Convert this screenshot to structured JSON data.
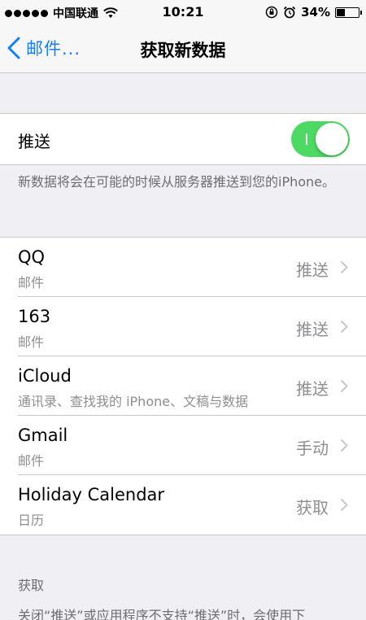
{
  "status_bar": {
    "carrier": "中国联通",
    "time": "10:21",
    "battery_percent": "34%",
    "battery_level": 0.34,
    "signal_bars": 5,
    "icons": [
      "wifi-icon",
      "orientation-lock-icon",
      "alarm-icon",
      "battery-icon"
    ]
  },
  "nav": {
    "back_label": "邮件...",
    "title": "获取新数据"
  },
  "push": {
    "label": "推送",
    "enabled": true,
    "description": "新数据将会在可能的时候从服务器推送到您的iPhone。"
  },
  "accounts": [
    {
      "name": "QQ",
      "subtitle": "邮件",
      "value": "推送"
    },
    {
      "name": "163",
      "subtitle": "邮件",
      "value": "推送"
    },
    {
      "name": "iCloud",
      "subtitle": "通讯录、查找我的 iPhone、文稿与数据",
      "value": "推送"
    },
    {
      "name": "Gmail",
      "subtitle": "邮件",
      "value": "手动"
    },
    {
      "name": "Holiday Calendar",
      "subtitle": "日历",
      "value": "获取"
    }
  ],
  "fetch": {
    "header": "获取",
    "description": "关闭“推送”或应用程序不支持“推送”时，会使用下"
  },
  "colors": {
    "accent": "#147efb",
    "toggle_on": "#4cd964",
    "background": "#efeff4",
    "secondary_text": "#8e8e93"
  }
}
